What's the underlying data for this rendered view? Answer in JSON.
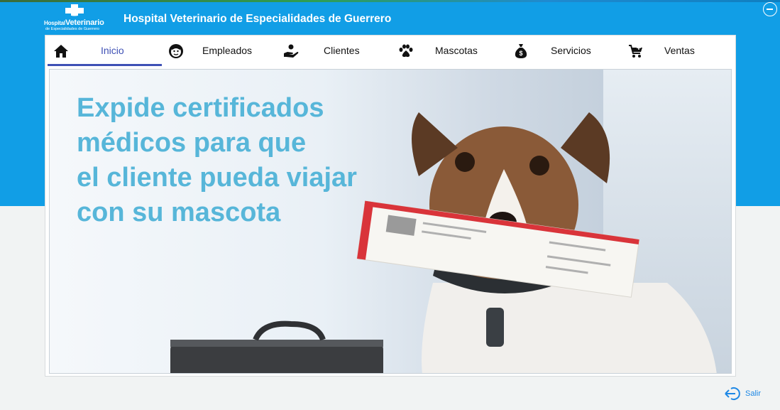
{
  "app": {
    "title": "Hospital Veterinario de Especialidades de Guerrero",
    "logo_line1_small": "Hospital",
    "logo_line1_big": "Veterinario",
    "logo_line2": "de Especialidades de Guerrero"
  },
  "nav": {
    "items": [
      {
        "label": "Inicio",
        "icon": "home-icon"
      },
      {
        "label": "Empleados",
        "icon": "employee-face-icon"
      },
      {
        "label": "Clientes",
        "icon": "hand-giving-icon"
      },
      {
        "label": "Mascotas",
        "icon": "paw-icon"
      },
      {
        "label": "Servicios",
        "icon": "money-bag-icon"
      },
      {
        "label": "Ventas",
        "icon": "shopping-cart-icon"
      }
    ],
    "active": "Inicio",
    "active_color": "#3f51b5"
  },
  "hero": {
    "lines": [
      "Expide certificados",
      "médicos para que",
      "el cliente pueda viajar",
      "con su mascota"
    ],
    "text_color": "#57b6d9"
  },
  "footer": {
    "exit_label": "Salir",
    "exit_icon": "logout-icon"
  },
  "colors": {
    "header_blue": "#119ee6",
    "background": "#f1f3f3"
  }
}
